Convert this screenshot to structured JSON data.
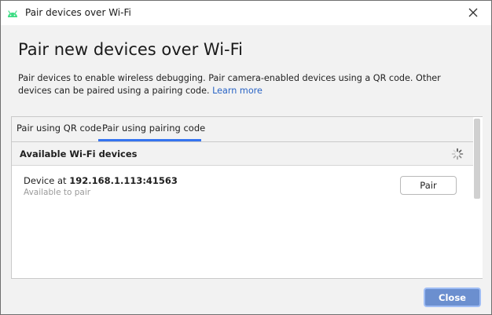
{
  "window": {
    "title": "Pair devices over Wi-Fi",
    "close_icon": "close-icon",
    "app_icon": "android-icon"
  },
  "header": {
    "title": "Pair new devices over Wi-Fi",
    "description": "Pair devices to enable wireless debugging. Pair camera-enabled devices using a QR code. Other devices can be paired using a pairing code.",
    "link_label": "Learn more"
  },
  "tabs": [
    {
      "label": "Pair using QR code",
      "selected": false
    },
    {
      "label": "Pair using pairing code",
      "selected": true
    }
  ],
  "list": {
    "header": "Available Wi-Fi devices",
    "loading_icon": "spinner-icon",
    "devices": [
      {
        "prefix": "Device at",
        "address": "192.168.1.113:41563",
        "status": "Available to pair",
        "action_label": "Pair"
      }
    ]
  },
  "footer": {
    "close_label": "Close"
  },
  "colors": {
    "accent": "#3574f0",
    "link": "#2a64c5",
    "primary_button": "#6b8fcf",
    "android_green": "#3ddc84"
  }
}
